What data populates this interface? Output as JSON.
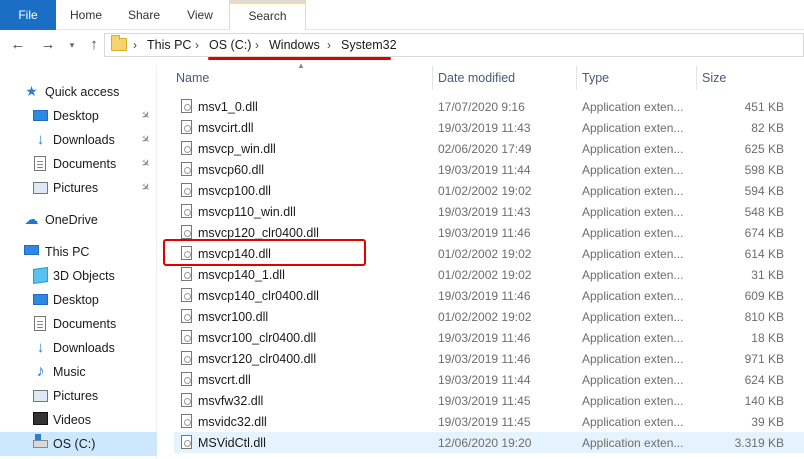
{
  "ribbon": {
    "tabs": [
      "File",
      "Home",
      "Share",
      "View",
      "Search"
    ]
  },
  "address": {
    "crumbs": [
      "This PC",
      "OS (C:)",
      "Windows",
      "System32"
    ],
    "separator": "›"
  },
  "nav_pane": {
    "items": [
      {
        "label": "Quick access",
        "icon": "star-icon"
      },
      {
        "label": "Desktop",
        "icon": "desktop-icon",
        "pinned": true
      },
      {
        "label": "Downloads",
        "icon": "download-icon",
        "pinned": true
      },
      {
        "label": "Documents",
        "icon": "documents-icon",
        "pinned": true
      },
      {
        "label": "Pictures",
        "icon": "pictures-icon",
        "pinned": true
      },
      {
        "label": "OneDrive",
        "icon": "cloud-icon"
      },
      {
        "label": "This PC",
        "icon": "computer-icon"
      },
      {
        "label": "3D Objects",
        "icon": "3d-objects-icon"
      },
      {
        "label": "Desktop",
        "icon": "desktop-icon"
      },
      {
        "label": "Documents",
        "icon": "documents-icon"
      },
      {
        "label": "Downloads",
        "icon": "download-icon"
      },
      {
        "label": "Music",
        "icon": "music-icon"
      },
      {
        "label": "Pictures",
        "icon": "pictures-icon"
      },
      {
        "label": "Videos",
        "icon": "videos-icon"
      },
      {
        "label": "OS (C:)",
        "icon": "drive-icon",
        "selected": true
      }
    ]
  },
  "columns": {
    "name": "Name",
    "date": "Date modified",
    "type": "Type",
    "size": "Size"
  },
  "files": [
    {
      "name": "msv1_0.dll",
      "date": "17/07/2020 9:16",
      "type": "Application exten...",
      "size": "451 KB"
    },
    {
      "name": "msvcirt.dll",
      "date": "19/03/2019 11:43",
      "type": "Application exten...",
      "size": "82 KB"
    },
    {
      "name": "msvcp_win.dll",
      "date": "02/06/2020 17:49",
      "type": "Application exten...",
      "size": "625 KB"
    },
    {
      "name": "msvcp60.dll",
      "date": "19/03/2019 11:44",
      "type": "Application exten...",
      "size": "598 KB"
    },
    {
      "name": "msvcp100.dll",
      "date": "01/02/2002 19:02",
      "type": "Application exten...",
      "size": "594 KB"
    },
    {
      "name": "msvcp110_win.dll",
      "date": "19/03/2019 11:43",
      "type": "Application exten...",
      "size": "548 KB"
    },
    {
      "name": "msvcp120_clr0400.dll",
      "date": "19/03/2019 11:46",
      "type": "Application exten...",
      "size": "674 KB"
    },
    {
      "name": "msvcp140.dll",
      "date": "01/02/2002 19:02",
      "type": "Application exten...",
      "size": "614 KB"
    },
    {
      "name": "msvcp140_1.dll",
      "date": "01/02/2002 19:02",
      "type": "Application exten...",
      "size": "31 KB"
    },
    {
      "name": "msvcp140_clr0400.dll",
      "date": "19/03/2019 11:46",
      "type": "Application exten...",
      "size": "609 KB"
    },
    {
      "name": "msvcr100.dll",
      "date": "01/02/2002 19:02",
      "type": "Application exten...",
      "size": "810 KB"
    },
    {
      "name": "msvcr100_clr0400.dll",
      "date": "19/03/2019 11:46",
      "type": "Application exten...",
      "size": "18 KB"
    },
    {
      "name": "msvcr120_clr0400.dll",
      "date": "19/03/2019 11:46",
      "type": "Application exten...",
      "size": "971 KB"
    },
    {
      "name": "msvcrt.dll",
      "date": "19/03/2019 11:44",
      "type": "Application exten...",
      "size": "624 KB"
    },
    {
      "name": "msvfw32.dll",
      "date": "19/03/2019 11:45",
      "type": "Application exten...",
      "size": "140 KB"
    },
    {
      "name": "msvidc32.dll",
      "date": "19/03/2019 11:45",
      "type": "Application exten...",
      "size": "39 KB"
    },
    {
      "name": "MSVidCtl.dll",
      "date": "12/06/2020 19:20",
      "type": "Application exten...",
      "size": "3.319 KB"
    }
  ],
  "highlight_color": "#e00000",
  "accent_color": "#1a6fc4"
}
